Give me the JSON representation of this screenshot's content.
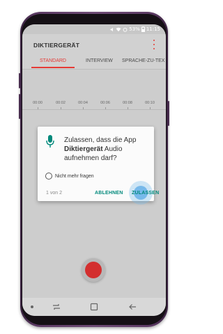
{
  "statusbar": {
    "icons": [
      "mute-icon",
      "wifi-icon",
      "alarm-icon",
      "signal-icon",
      "battery-icon"
    ],
    "battery": "53%",
    "time": "11:15"
  },
  "app": {
    "title": "DIKTIERGERÄT",
    "menu_icon": "more-vert-icon"
  },
  "tabs": [
    {
      "label": "STANDARD",
      "active": true
    },
    {
      "label": "INTERVIEW",
      "active": false
    },
    {
      "label": "SPRACHE-ZU-TEX",
      "active": false
    }
  ],
  "timeline": {
    "labels": [
      "00:00",
      "00:02",
      "00:04",
      "00:06",
      "00:08",
      "00:10"
    ]
  },
  "dialog": {
    "icon": "mic-icon",
    "text_prefix": "Zulassen, dass die App ",
    "app_name": "Diktiergerät",
    "text_suffix": " Audio aufnehmen darf?",
    "checkbox_label": "Nicht mehr fragen",
    "checkbox_checked": false,
    "page_count": "1 von 2",
    "deny_label": "ABLEHNEN",
    "allow_label": "ZULASSEN"
  },
  "record_button": {
    "icon": "record-icon"
  },
  "navbar": {
    "items": [
      "dot-icon",
      "recent-apps-icon",
      "home-icon",
      "back-icon"
    ]
  },
  "colors": {
    "accent": "#e53935",
    "dialog_button": "#00897b",
    "mic": "#00897b",
    "phone_frame": "#5b3a63"
  }
}
